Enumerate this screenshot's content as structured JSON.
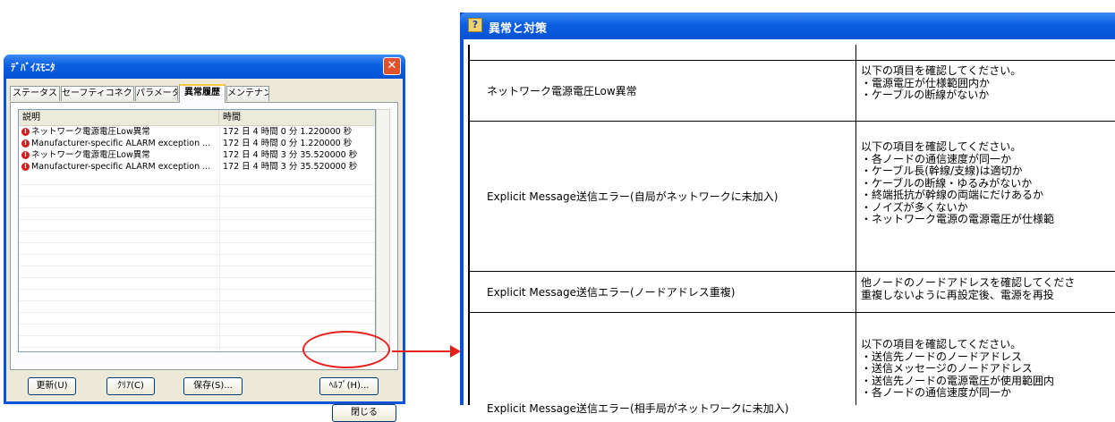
{
  "device_monitor": {
    "title": "ﾃﾞﾊﾞｲｽﾓﾆﾀ",
    "tabs": [
      "ステータス",
      "セーフティコネクション",
      "パラメータ",
      "異常履歴",
      "メンテナンス"
    ],
    "active_tab": "異常履歴",
    "columns": [
      "説明",
      "時間"
    ],
    "rows": [
      {
        "desc": "ネットワーク電源電圧Low異常",
        "time": "172 日 4 時間 0 分 1.220000 秒"
      },
      {
        "desc": "Manufacturer-specific ALARM exception ...",
        "time": "172 日 4 時間 0 分 1.220000 秒"
      },
      {
        "desc": "ネットワーク電源電圧Low異常",
        "time": "172 日 4 時間 3 分 35.520000 秒"
      },
      {
        "desc": "Manufacturer-specific ALARM exception ...",
        "time": "172 日 4 時間 3 分 35.520000 秒"
      }
    ],
    "buttons": {
      "refresh": "更新(U)",
      "clear": "ｸﾘｱ(C)",
      "save": "保存(S)...",
      "help": "ﾍﾙﾌﾟ(H)...",
      "close": "閉じる"
    }
  },
  "help_window": {
    "title": "異常と対策",
    "entries": [
      {
        "cause": "ネットワーク電源電圧Low異常",
        "checks": [
          "以下の項目を確認してください。",
          "・電源電圧が仕様範囲内か",
          "・ケーブルの断線がないか"
        ]
      },
      {
        "cause": "Explicit Message送信エラー(自局がネットワークに未加入)",
        "checks": [
          "以下の項目を確認してください。",
          "・各ノードの通信速度が同一か",
          "・ケーブル長(幹線/支線)は適切か",
          "・ケーブルの断線・ゆるみがないか",
          "・終端抵抗が幹線の両端にだけあるか",
          "・ノイズが多くないか",
          "・ネットワーク電源の電源電圧が仕様範"
        ]
      },
      {
        "cause": "Explicit Message送信エラー(ノードアドレス重複)",
        "checks": [
          "他ノードのノードアドレスを確認してくださ",
          "重複しないように再設定後、電源を再投"
        ]
      },
      {
        "cause": "Explicit Message送信エラー(相手局がネットワークに未加入)",
        "checks": [
          "以下の項目を確認してください。",
          "・送信先ノードのノードアドレス",
          "・送信メッセージのノードアドレス",
          "・送信先ノードの電源電圧が使用範囲内",
          "・各ノードの通信速度が同一か"
        ]
      }
    ]
  },
  "colors": {
    "titlebar": "#0a5ee0",
    "highlight": "#e8201e",
    "error": "#d21e1e"
  }
}
